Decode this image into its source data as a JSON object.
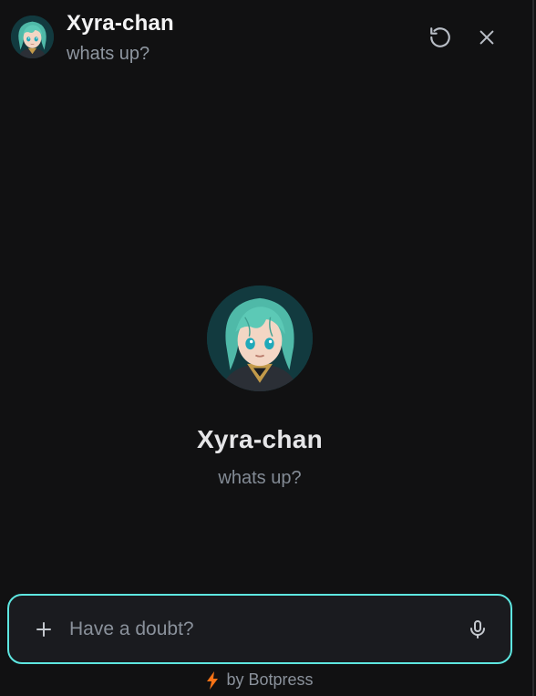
{
  "header": {
    "title": "Xyra-chan",
    "subtitle": "whats up?",
    "refresh_icon": "refresh-icon",
    "close_icon": "close-icon"
  },
  "profile": {
    "name": "Xyra-chan",
    "subtitle": "whats up?",
    "avatar_icon": "anime-avatar"
  },
  "composer": {
    "placeholder": "Have a doubt?",
    "value": "",
    "add_icon": "plus-icon",
    "mic_icon": "microphone-icon"
  },
  "footer": {
    "text": "by Botpress",
    "icon": "bolt-icon"
  },
  "colors": {
    "background": "#111112",
    "accent": "#5ee6e0",
    "bolt": "#f97316"
  }
}
